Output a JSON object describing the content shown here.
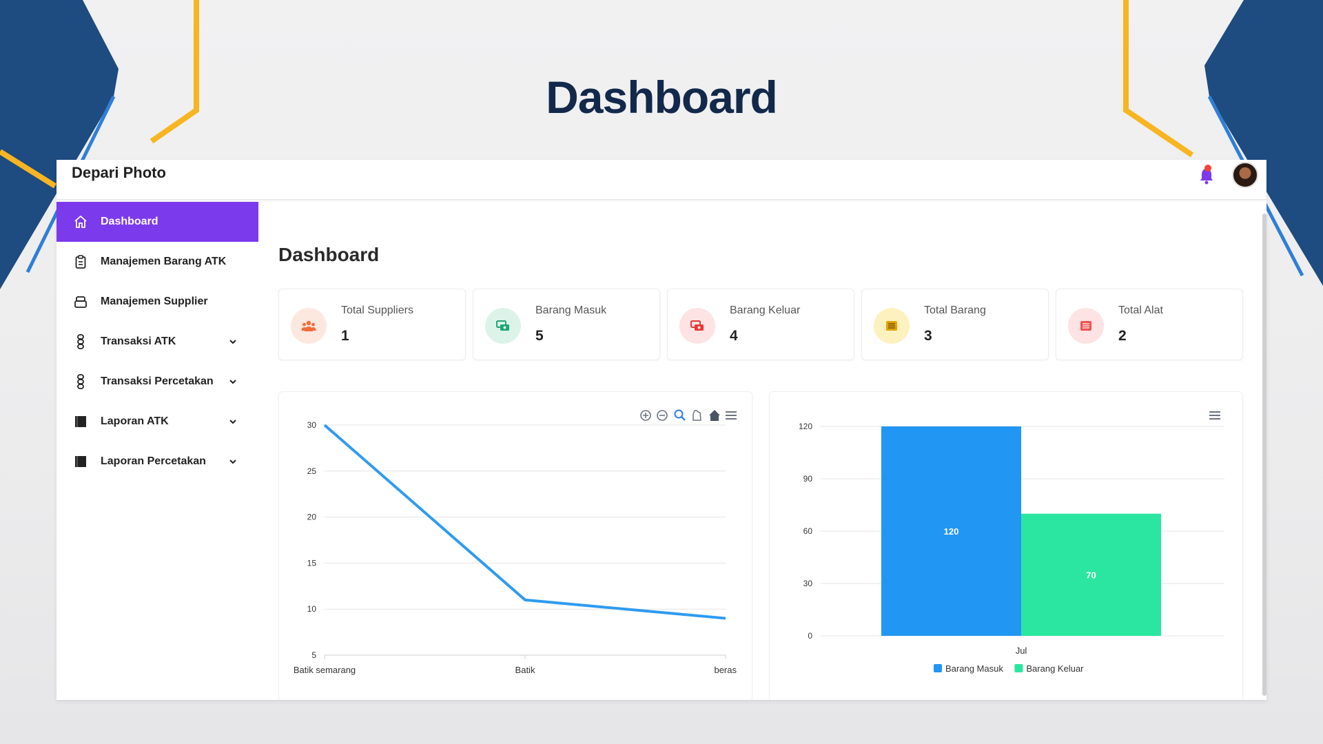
{
  "slide": {
    "title": "Dashboard"
  },
  "app": {
    "brand": "Depari Photo"
  },
  "sidebar": {
    "items": [
      {
        "label": "Dashboard",
        "icon": "home-icon",
        "active": true,
        "has_chevron": false
      },
      {
        "label": "Manajemen Barang ATK",
        "icon": "clipboard-icon",
        "active": false,
        "has_chevron": false
      },
      {
        "label": "Manajemen Supplier",
        "icon": "box-icon",
        "active": false,
        "has_chevron": false
      },
      {
        "label": "Transaksi ATK",
        "icon": "transaction-icon",
        "active": false,
        "has_chevron": true
      },
      {
        "label": "Transaksi Percetakan",
        "icon": "transaction-icon",
        "active": false,
        "has_chevron": true
      },
      {
        "label": "Laporan ATK",
        "icon": "book-icon",
        "active": false,
        "has_chevron": true
      },
      {
        "label": "Laporan Percetakan",
        "icon": "book-icon",
        "active": false,
        "has_chevron": true
      }
    ]
  },
  "main": {
    "title": "Dashboard",
    "cards": [
      {
        "label": "Total Suppliers",
        "value": "1",
        "icon": "users-icon",
        "color": "#f26b3a",
        "bg": "#fde8df"
      },
      {
        "label": "Barang Masuk",
        "value": "5",
        "icon": "cash-in-icon",
        "color": "#1fa774",
        "bg": "#dcf3e9"
      },
      {
        "label": "Barang Keluar",
        "value": "4",
        "icon": "cash-out-icon",
        "color": "#e53935",
        "bg": "#fde3e3"
      },
      {
        "label": "Total Barang",
        "value": "3",
        "icon": "list-icon",
        "color": "#b07800",
        "bg": "#fdf1bf"
      },
      {
        "label": "Total Alat",
        "value": "2",
        "icon": "list-icon",
        "color": "#e53935",
        "bg": "#fde3e3"
      }
    ]
  },
  "colors": {
    "accent": "#7c3aed",
    "line": "#2e9bf0",
    "bar_in": "#2196f3",
    "bar_out": "#2ae6a0",
    "title": "#13294b"
  },
  "chart_data": [
    {
      "type": "line",
      "categories": [
        "Batik semarang",
        "Batik",
        "beras"
      ],
      "series": [
        {
          "values": [
            30,
            11,
            9
          ]
        }
      ],
      "ylim": [
        5,
        30
      ],
      "yticks": [
        "5",
        "10",
        "15",
        "20",
        "25",
        "30"
      ],
      "grid": true,
      "toolbar": [
        "zoom-in-icon",
        "zoom-out-icon",
        "magnifier-icon",
        "pan-hand-icon",
        "home-icon",
        "menu-icon"
      ]
    },
    {
      "type": "bar",
      "categories": [
        "Jul"
      ],
      "series": [
        {
          "name": "Barang Masuk",
          "values": [
            120
          ],
          "color": "#2196f3"
        },
        {
          "name": "Barang Keluar",
          "values": [
            70
          ],
          "color": "#2ae6a0"
        }
      ],
      "ylim": [
        0,
        120
      ],
      "yticks": [
        "0",
        "30",
        "60",
        "90",
        "120"
      ],
      "data_labels": [
        "120",
        "70"
      ],
      "grid": true,
      "legend": "bottom",
      "toolbar": [
        "menu-icon"
      ]
    }
  ]
}
